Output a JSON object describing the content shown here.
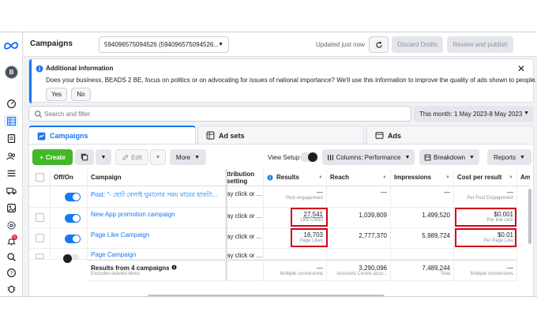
{
  "topbar": {
    "title": "Campaigns",
    "account": "594096575094526 (594096575094526...",
    "updated": "Updated just now",
    "discard": "Discard Drafts",
    "review": "Review and publish"
  },
  "rail": {
    "avatar_letter": "B",
    "badge": "5",
    "icons": [
      "meta-logo-icon",
      "dashboard-icon",
      "table-icon",
      "pages-icon",
      "audience-icon",
      "list-icon",
      "truck-icon",
      "media-icon",
      "settings-icon",
      "notifications-icon",
      "search-icon",
      "help-icon",
      "bug-icon"
    ]
  },
  "info": {
    "heading": "Additional information",
    "text": "Does your business, BEADS 2 BE, focus on politics or on advocating for issues of national importance? We'll use this information to improve the quality of ads shown to people.",
    "yes": "Yes",
    "no": "No"
  },
  "search": {
    "placeholder": "Search and filter"
  },
  "date_range": "This month: 1 May 2023-8 May 2023",
  "tabs": {
    "campaigns": "Campaigns",
    "adsets": "Ad sets",
    "ads": "Ads"
  },
  "toolbar": {
    "create": "Create",
    "edit": "Edit",
    "more": "More",
    "view_setup": "View Setup",
    "columns": "Columns: Performance",
    "breakdown": "Breakdown",
    "reports": "Reports"
  },
  "table": {
    "headers": {
      "offon": "Off/On",
      "campaign": "Campaign",
      "attribution": "ttribution\nsetting",
      "results": "Results",
      "reach": "Reach",
      "impressions": "Impressions",
      "cpr": "Cost per result",
      "amount": "Amo"
    },
    "rows": [
      {
        "name": "Post: \"- ছোট বেলাই ঘুমানোর সময় মায়ের হাতটা...",
        "attribution": "ay click or ...",
        "results": "—",
        "results_sub": "Post engagement",
        "reach": "—",
        "impressions": "—",
        "cpr": "—",
        "cpr_sub": "Per Post Engagement"
      },
      {
        "name": "New App promotion campaign",
        "attribution": "ay click or ...",
        "results": "27,541",
        "results_sub": "Link Clicks",
        "reach": "1,039,809",
        "impressions": "1,499,520",
        "cpr": "$0.001",
        "cpr_sub": "Per link click"
      },
      {
        "name": "Page Like Campaign",
        "attribution": "ay click or ...",
        "results": "16,703",
        "results_sub": "Page Likes",
        "reach": "2,777,370",
        "impressions": "5,989,724",
        "cpr": "$0.01",
        "cpr_sub": "Per Page Like"
      },
      {
        "name": "Page Campaign",
        "attribution": "ay click or ...",
        "results": "",
        "results_sub": "",
        "reach": "",
        "impressions": "",
        "cpr": "",
        "cpr_sub": ""
      }
    ],
    "totals": {
      "label": "Results from 4 campaigns",
      "sub": "Excludes deleted items",
      "results": "—",
      "results_sub": "Multiple conversions",
      "reach": "3,290,096",
      "reach_sub": "Accounts Centre acco...",
      "impressions": "7,489,244",
      "impressions_sub": "Total",
      "cpr": "—",
      "cpr_sub": "Multiple conversions"
    }
  },
  "colors": {
    "accent": "#1877f2",
    "create": "#42b72a",
    "highlight": "#d0021b"
  }
}
